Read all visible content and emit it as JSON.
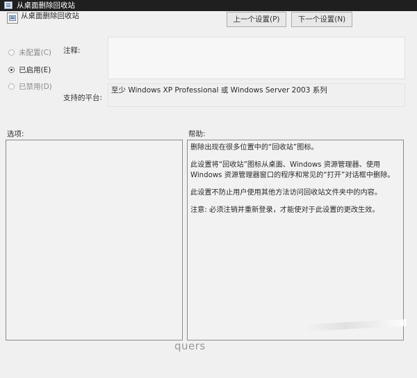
{
  "window": {
    "title": "从桌面删除回收站"
  },
  "header": {
    "title": "从桌面删除回收站",
    "prev_button": "上一个设置(P)",
    "next_button": "下一个设置(N)"
  },
  "radios": [
    {
      "label": "未配置(C)",
      "checked": false
    },
    {
      "label": "已启用(E)",
      "checked": true
    },
    {
      "label": "已禁用(D)",
      "checked": false
    }
  ],
  "comment_label": "注释:",
  "platform_label": "支持的平台:",
  "platform_value": "至少 Windows XP Professional 或 Windows Server 2003 系列",
  "options_label": "选项:",
  "help_label": "帮助:",
  "help_text": [
    "删除出现在很多位置中的“回收站”图标。",
    "此设置将“回收站”图标从桌面、Windows 资源管理器、使用 Windows 资源管理器窗口的程序和常见的“打开”对话框中删除。",
    "此设置不防止用户使用其他方法访问回收站文件夹中的内容。",
    "注意: 必须注销并重新登录，才能使对于此设置的更改生效。"
  ],
  "watermark": "quers"
}
